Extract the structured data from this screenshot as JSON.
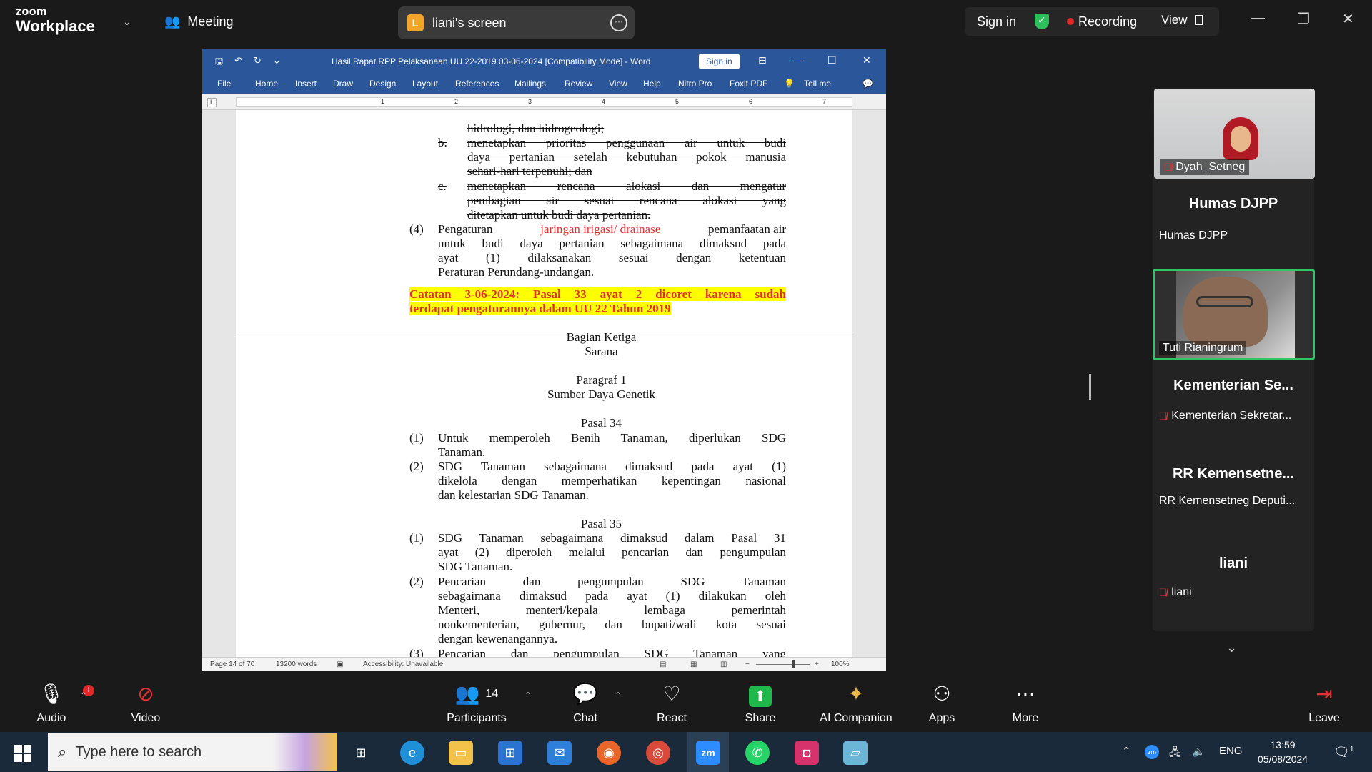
{
  "app": {
    "logo_top": "zoom",
    "logo_bottom": "Workplace",
    "meeting_label": "Meeting",
    "shared_screen_initial": "L",
    "shared_screen_label": "liani's screen",
    "sign_in": "Sign in",
    "recording": "Recording",
    "view": "View"
  },
  "word": {
    "title": "Hasil Rapat RPP Pelaksanaan UU 22-2019 03-06-2024 [Compatibility Mode]  -  Word",
    "sign_in": "Sign in",
    "tabs": [
      "File",
      "Home",
      "Insert",
      "Draw",
      "Design",
      "Layout",
      "References",
      "Mailings",
      "Review",
      "View",
      "Help",
      "Nitro Pro",
      "Foxit PDF",
      "Tell me"
    ],
    "ruler_marks": [
      "1",
      "2",
      "3",
      "4",
      "5",
      "6",
      "7"
    ],
    "status": {
      "page": "Page 14 of 70",
      "words": "13200 words",
      "accessibility": "Accessibility: Unavailable",
      "zoom": "100%"
    }
  },
  "doc": {
    "line_a_tail": "hidrologi, dan hidrogeologi;",
    "b_label": "b.",
    "b_l1": "menetapkan prioritas penggunaan air untuk budi",
    "b_l2": "daya pertanian setelah kebutuhan pokok manusia",
    "b_l3": "sehari-hari terpenuhi; dan",
    "c_label": "c.",
    "c_l1": "menetapkan rencana alokasi dan mengatur",
    "c_l2": "pembagian air sesuai rencana alokasi yang",
    "c_l3": "ditetapkan untuk budi daya pertanian.",
    "p4_label": "(4)",
    "p4_a": "Pengaturan ",
    "p4_red": "jaringan irigasi/ drainase",
    "p4_strike": "pemanfaatan air",
    "p4_l2": "untuk budi daya pertanian sebagaimana dimaksud pada",
    "p4_l3": "ayat (1) dilaksanakan sesuai dengan ketentuan",
    "p4_l4": "Peraturan Perundang-undangan.",
    "note_l1": "Catatan 3-06-2024: Pasal 33 ayat 2 dicoret karena sudah",
    "note_l2": "terdapat pengaturannya dalam UU 22 Tahun 2019",
    "bagian": "Bagian Ketiga",
    "sarana": "Sarana",
    "paragraf": "Paragraf 1",
    "sdg_title": "Sumber Daya Genetik",
    "pasal34": "Pasal 34",
    "p34_1_label": "(1)",
    "p34_1_l1": "Untuk memperoleh Benih Tanaman, diperlukan SDG",
    "p34_1_l2": "Tanaman.",
    "p34_2_label": "(2)",
    "p34_2_l1": "SDG Tanaman sebagaimana dimaksud pada ayat (1)",
    "p34_2_l2": "dikelola dengan memperhatikan kepentingan nasional",
    "p34_2_l3": "dan kelestarian SDG Tanaman.",
    "pasal35": "Pasal 35",
    "p35_1_label": "(1)",
    "p35_1_l1": "SDG Tanaman sebagaimana dimaksud dalam Pasal 31",
    "p35_1_l2": "ayat (2) diperoleh melalui pencarian dan pengumpulan",
    "p35_1_l3": "SDG Tanaman.",
    "p35_2_label": "(2)",
    "p35_2_l1": "Pencarian dan pengumpulan SDG Tanaman",
    "p35_2_l2": "sebagaimana dimaksud pada ayat (1) dilakukan oleh",
    "p35_2_l3": "Menteri, menteri/kepala lembaga pemerintah",
    "p35_2_l4": "nonkementerian, gubernur, dan bupati/wali kota sesuai",
    "p35_2_l5": "dengan kewenangannya.",
    "p35_3_label": "(3)",
    "p35_3_l1": "Pencarian dan pengumpulan SDG Tanaman yang"
  },
  "participants": {
    "p1_name": "Dyah_Setneg",
    "p2_big": "Humas DJPP",
    "p2_small": "Humas DJPP",
    "p3_name": "Tuti Rianingrum",
    "p4_big": "Kementerian  Se...",
    "p4_small": "Kementerian Sekretar...",
    "p5_big": "RR  Kemensetne...",
    "p5_small": "RR Kemensetneg Deputi...",
    "p6_big": "liani",
    "p6_small": "liani"
  },
  "toolbar": {
    "audio": "Audio",
    "audio_badge": "!",
    "video": "Video",
    "participants": "Participants",
    "participants_count": "14",
    "chat": "Chat",
    "react": "React",
    "share": "Share",
    "ai": "AI Companion",
    "apps": "Apps",
    "more": "More",
    "leave": "Leave"
  },
  "taskbar": {
    "search_placeholder": "Type here to search",
    "lang": "ENG",
    "time": "13:59",
    "date": "05/08/2024",
    "notif_count": "1"
  },
  "colors": {
    "word_blue": "#2b579a",
    "zoom_green": "#2ec56b",
    "recording_red": "#e02828",
    "highlight_yellow": "#ffff00",
    "revision_red": "#e03232"
  }
}
